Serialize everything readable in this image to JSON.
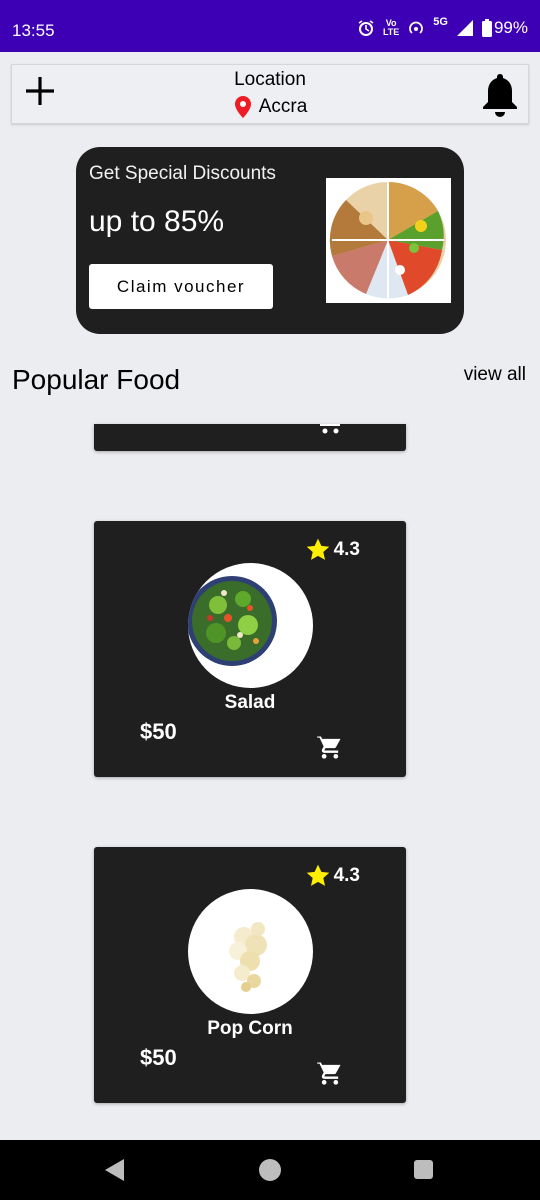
{
  "status_bar": {
    "time": "13:55",
    "battery": "99%",
    "network": "5G",
    "volte_top": "Vo",
    "volte_bottom": "LTE",
    "icons": [
      "alarm-icon",
      "volte-icon",
      "hotspot-icon",
      "signal-icon",
      "battery-icon"
    ]
  },
  "header": {
    "location_label": "Location",
    "location_city": "Accra",
    "icons": [
      "plus-icon",
      "location-pin-icon",
      "bell-icon"
    ],
    "pin_color": "#ee1c25"
  },
  "promo": {
    "title": "Get Special Discounts",
    "discount": "up to 85%",
    "button_label": "Claim voucher"
  },
  "section": {
    "title": "Popular Food",
    "view_all": "view all"
  },
  "foods": [
    {
      "name": "Salad",
      "price": "$50",
      "rating": "4.3",
      "image": "salad-bowl"
    },
    {
      "name": "Pop Corn",
      "price": "$50",
      "rating": "4.3",
      "image": "popcorn"
    }
  ],
  "colors": {
    "status_bar": "#3d00b5",
    "card_bg": "#1f1f1f",
    "star": "#ffee00",
    "page_bg": "#ecedf1"
  }
}
